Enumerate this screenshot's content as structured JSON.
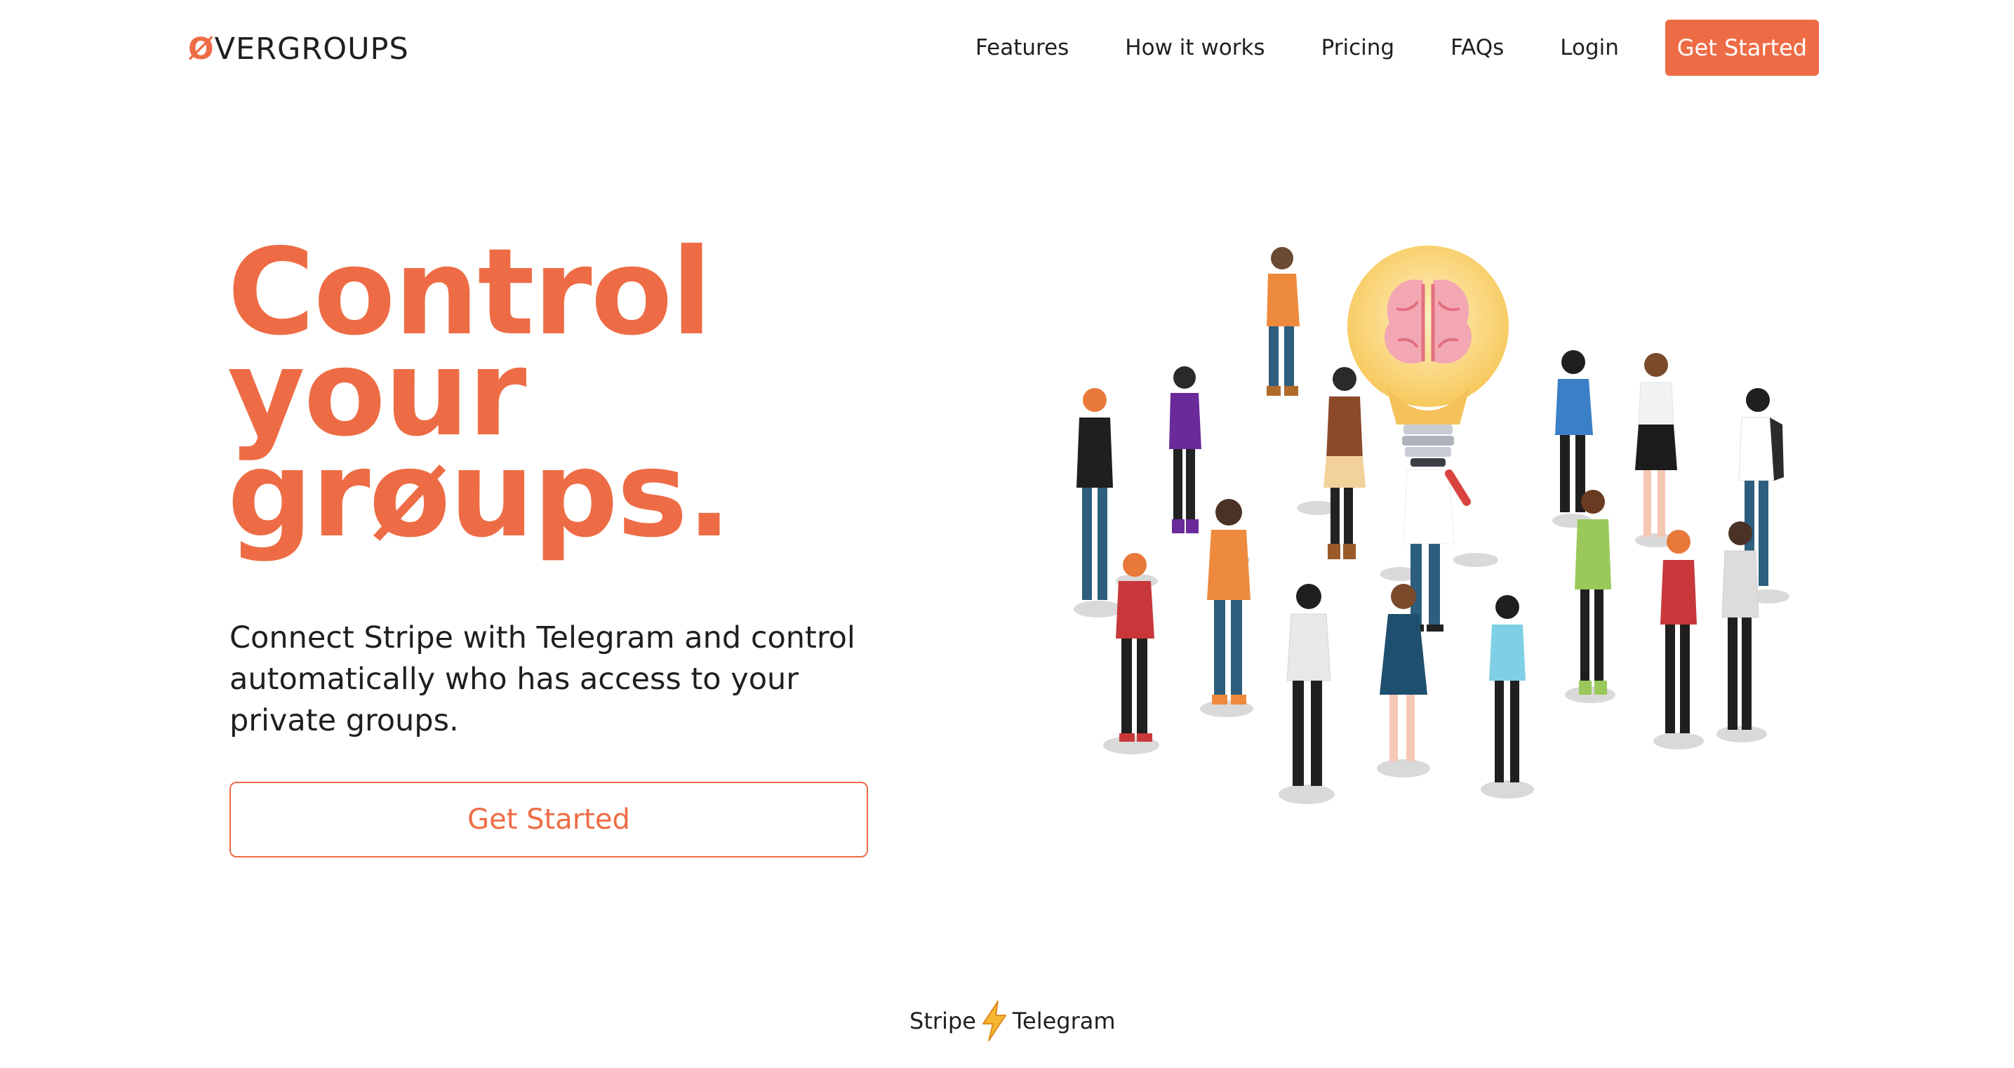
{
  "brand": {
    "logo_mark": "Ø",
    "logo_text": "VERGROUPS",
    "accent_color": "#ee6c45"
  },
  "nav": {
    "links": [
      "Features",
      "How it works",
      "Pricing",
      "FAQs",
      "Login"
    ],
    "cta_label": "Get Started"
  },
  "hero": {
    "headline": [
      "Control",
      "your",
      "grøups."
    ],
    "subtitle": "Connect Stripe with Telegram and control automatically who has access to your private groups.",
    "cta_label": "Get Started",
    "illustration_icon": "people-around-lightbulb-brain-illustration"
  },
  "integration": {
    "left": "Stripe",
    "icon": "lightning-bolt-icon",
    "right": "Telegram"
  }
}
